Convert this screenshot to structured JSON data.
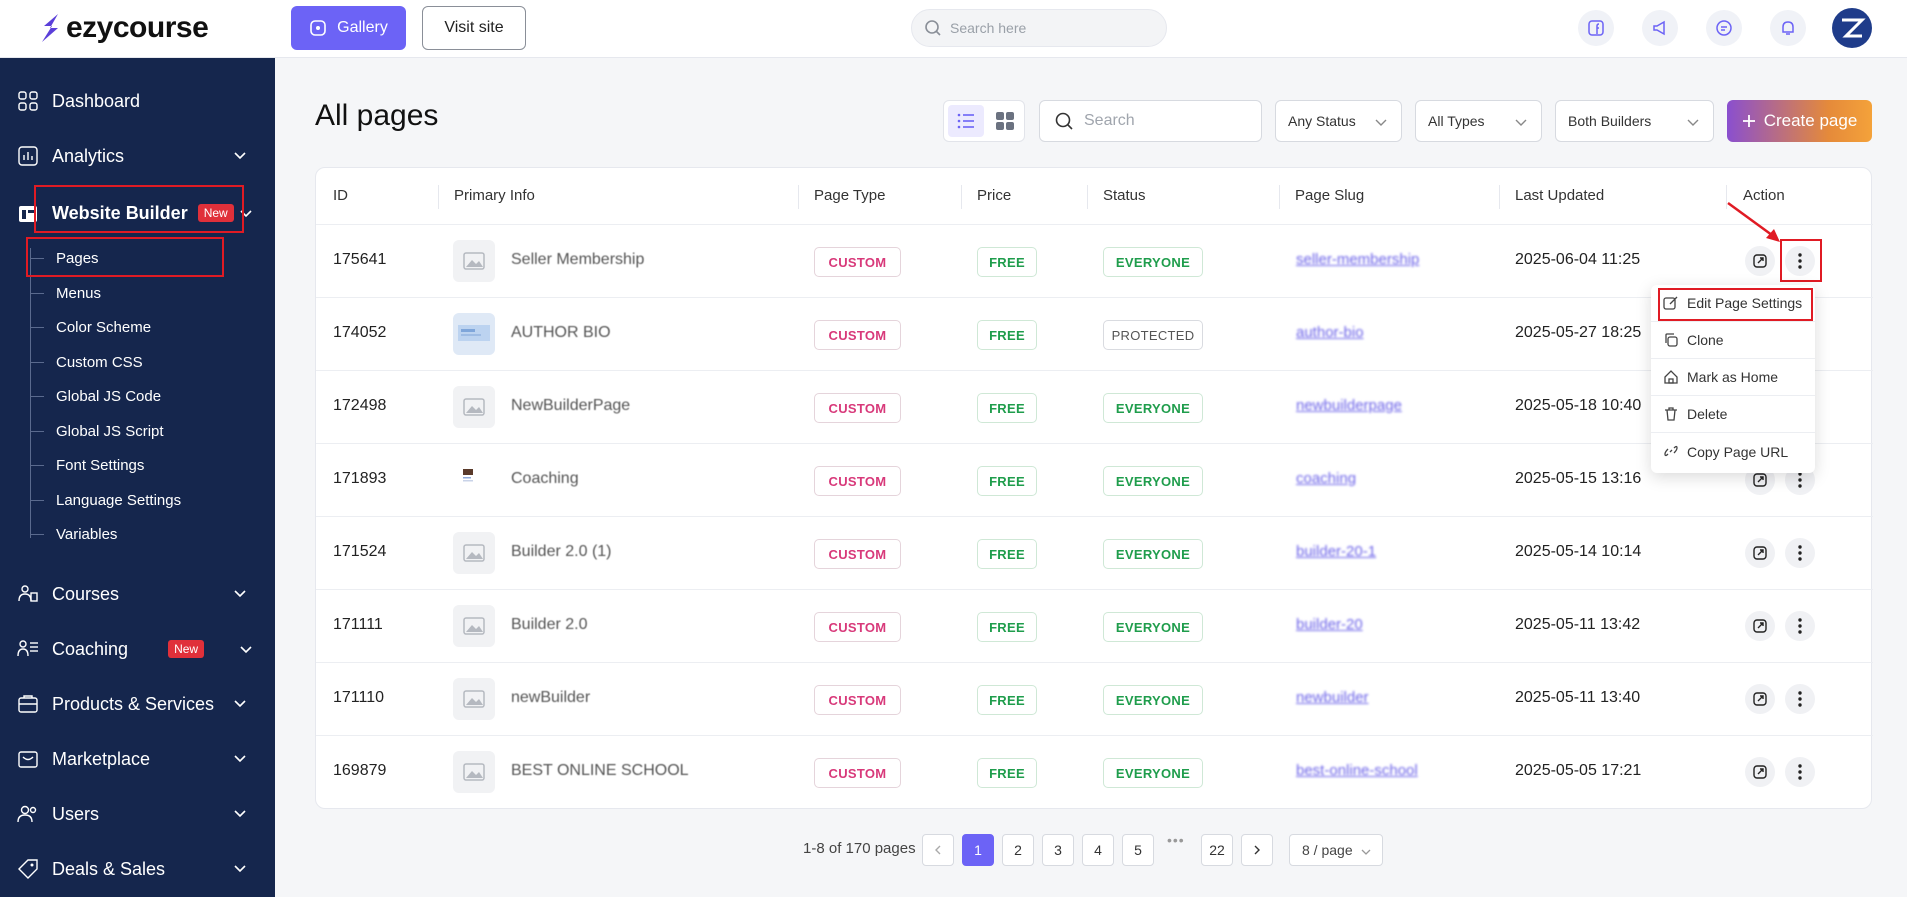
{
  "brand": {
    "name": "ezycourse"
  },
  "topbar": {
    "gallery_label": "Gallery",
    "visit_label": "Visit site",
    "search_placeholder": "Search here"
  },
  "sidebar": {
    "items": [
      {
        "label": "Dashboard",
        "icon": "dashboard-icon"
      },
      {
        "label": "Analytics",
        "icon": "analytics-icon"
      },
      {
        "label": "Website Builder",
        "icon": "website-builder-icon",
        "badge": "New"
      },
      {
        "label": "Courses",
        "icon": "courses-icon"
      },
      {
        "label": "Coaching",
        "icon": "coaching-icon",
        "badge": "New"
      },
      {
        "label": "Products & Services",
        "icon": "products-icon"
      },
      {
        "label": "Marketplace",
        "icon": "marketplace-icon"
      },
      {
        "label": "Users",
        "icon": "users-icon"
      },
      {
        "label": "Deals & Sales",
        "icon": "deals-icon"
      }
    ],
    "sub_items": [
      "Pages",
      "Menus",
      "Color Scheme",
      "Custom CSS",
      "Global JS Code",
      "Global JS Script",
      "Font Settings",
      "Language Settings",
      "Variables"
    ]
  },
  "main": {
    "title": "All pages",
    "search_placeholder": "Search",
    "filters": {
      "status": "Any Status",
      "types": "All Types",
      "builders": "Both Builders"
    },
    "create_label": "Create page"
  },
  "table": {
    "columns": [
      "ID",
      "Primary Info",
      "Page Type",
      "Price",
      "Status",
      "Page Slug",
      "Last Updated",
      "Action"
    ],
    "rows": [
      {
        "id": "175641",
        "name": "Seller Membership",
        "type": "CUSTOM",
        "price": "FREE",
        "status": "EVERYONE",
        "slug": "seller-membership",
        "updated": "2025-06-04 11:25"
      },
      {
        "id": "174052",
        "name": "AUTHOR BIO",
        "type": "CUSTOM",
        "price": "FREE",
        "status": "PROTECTED",
        "slug": "author-bio",
        "updated": "2025-05-27 18:25"
      },
      {
        "id": "172498",
        "name": "NewBuilderPage",
        "type": "CUSTOM",
        "price": "FREE",
        "status": "EVERYONE",
        "slug": "newbuilderpage",
        "updated": "2025-05-18 10:40"
      },
      {
        "id": "171893",
        "name": "Coaching",
        "type": "CUSTOM",
        "price": "FREE",
        "status": "EVERYONE",
        "slug": "coaching",
        "updated": "2025-05-15 13:16"
      },
      {
        "id": "171524",
        "name": "Builder 2.0 (1)",
        "type": "CUSTOM",
        "price": "FREE",
        "status": "EVERYONE",
        "slug": "builder-20-1",
        "updated": "2025-05-14 10:14"
      },
      {
        "id": "171111",
        "name": "Builder 2.0",
        "type": "CUSTOM",
        "price": "FREE",
        "status": "EVERYONE",
        "slug": "builder-20",
        "updated": "2025-05-11 13:42"
      },
      {
        "id": "171110",
        "name": "newBuilder",
        "type": "CUSTOM",
        "price": "FREE",
        "status": "EVERYONE",
        "slug": "newbuilder",
        "updated": "2025-05-11 13:40"
      },
      {
        "id": "169879",
        "name": "BEST ONLINE SCHOOL",
        "type": "CUSTOM",
        "price": "FREE",
        "status": "EVERYONE",
        "slug": "best-online-school",
        "updated": "2025-05-05 17:21"
      }
    ]
  },
  "dropdown": {
    "items": [
      "Edit Page Settings",
      "Clone",
      "Mark as Home",
      "Delete",
      "Copy Page URL"
    ]
  },
  "pagination": {
    "info": "1-8 of 170 pages",
    "pages": [
      "1",
      "2",
      "3",
      "4",
      "5"
    ],
    "last_page": "22",
    "per_page": "8 / page",
    "dots": "•••"
  },
  "colors": {
    "accent": "#6c63f6",
    "sidebar": "#15264d",
    "highlight": "#e01b24"
  }
}
